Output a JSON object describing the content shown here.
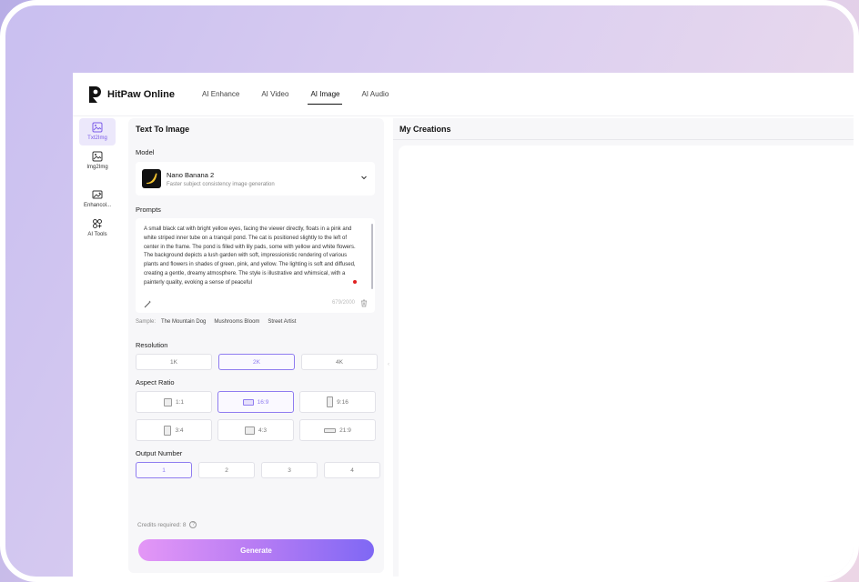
{
  "app": {
    "name": "HitPaw Online"
  },
  "nav": [
    {
      "label": "AI Enhance"
    },
    {
      "label": "AI Video"
    },
    {
      "label": "AI Image",
      "active": true
    },
    {
      "label": "AI Audio"
    }
  ],
  "rail": [
    {
      "label": "Txt2Img",
      "icon": "text-image-icon",
      "active": true
    },
    {
      "label": "Img2Img",
      "icon": "image-image-icon"
    },
    {
      "label": "Enhancol...",
      "icon": "enhance-icon"
    },
    {
      "label": "AI Tools",
      "icon": "ai-tools-icon"
    }
  ],
  "panel": {
    "title": "Text To Image",
    "model_label": "Model",
    "model": {
      "name": "Nano Banana 2",
      "description": "Faster subject consistency image generation"
    },
    "prompts_label": "Prompts",
    "prompt_text": "A small black cat with bright yellow eyes, facing the viewer directly, floats in a pink and white striped inner tube on a tranquil pond. The cat is positioned slightly to the left of center in the frame. The pond is filled with lily pads, some with yellow and white flowers. The background depicts a lush garden with soft, impressionistic rendering of various plants and flowers in shades of green, pink, and yellow. The lighting is soft and diffused, creating a gentle, dreamy atmosphere. The style is illustrative and whimsical, with a painterly quality, evoking a sense of peaceful",
    "char_count": "679/2000",
    "sample_label": "Sample:",
    "samples": [
      "The Mountain Dog",
      "Mushrooms Bloom",
      "Street Artist"
    ],
    "resolution_label": "Resolution",
    "resolutions": [
      "1K",
      "2K",
      "4K"
    ],
    "resolution_selected": "2K",
    "aspect_label": "Aspect Ratio",
    "aspect_ratios": [
      "1:1",
      "16:9",
      "9:16",
      "3:4",
      "4:3",
      "21:9"
    ],
    "aspect_selected": "16:9",
    "output_label": "Output Number",
    "outputs": [
      "1",
      "2",
      "3",
      "4"
    ],
    "output_selected": "1",
    "credits": "Credits required: 8",
    "help_glyph": "?",
    "generate_label": "Generate"
  },
  "creations": {
    "title": "My Creations"
  },
  "colors": {
    "accent": "#8f7cf0",
    "gradient_start": "#e497f6",
    "gradient_end": "#7f68f4"
  }
}
